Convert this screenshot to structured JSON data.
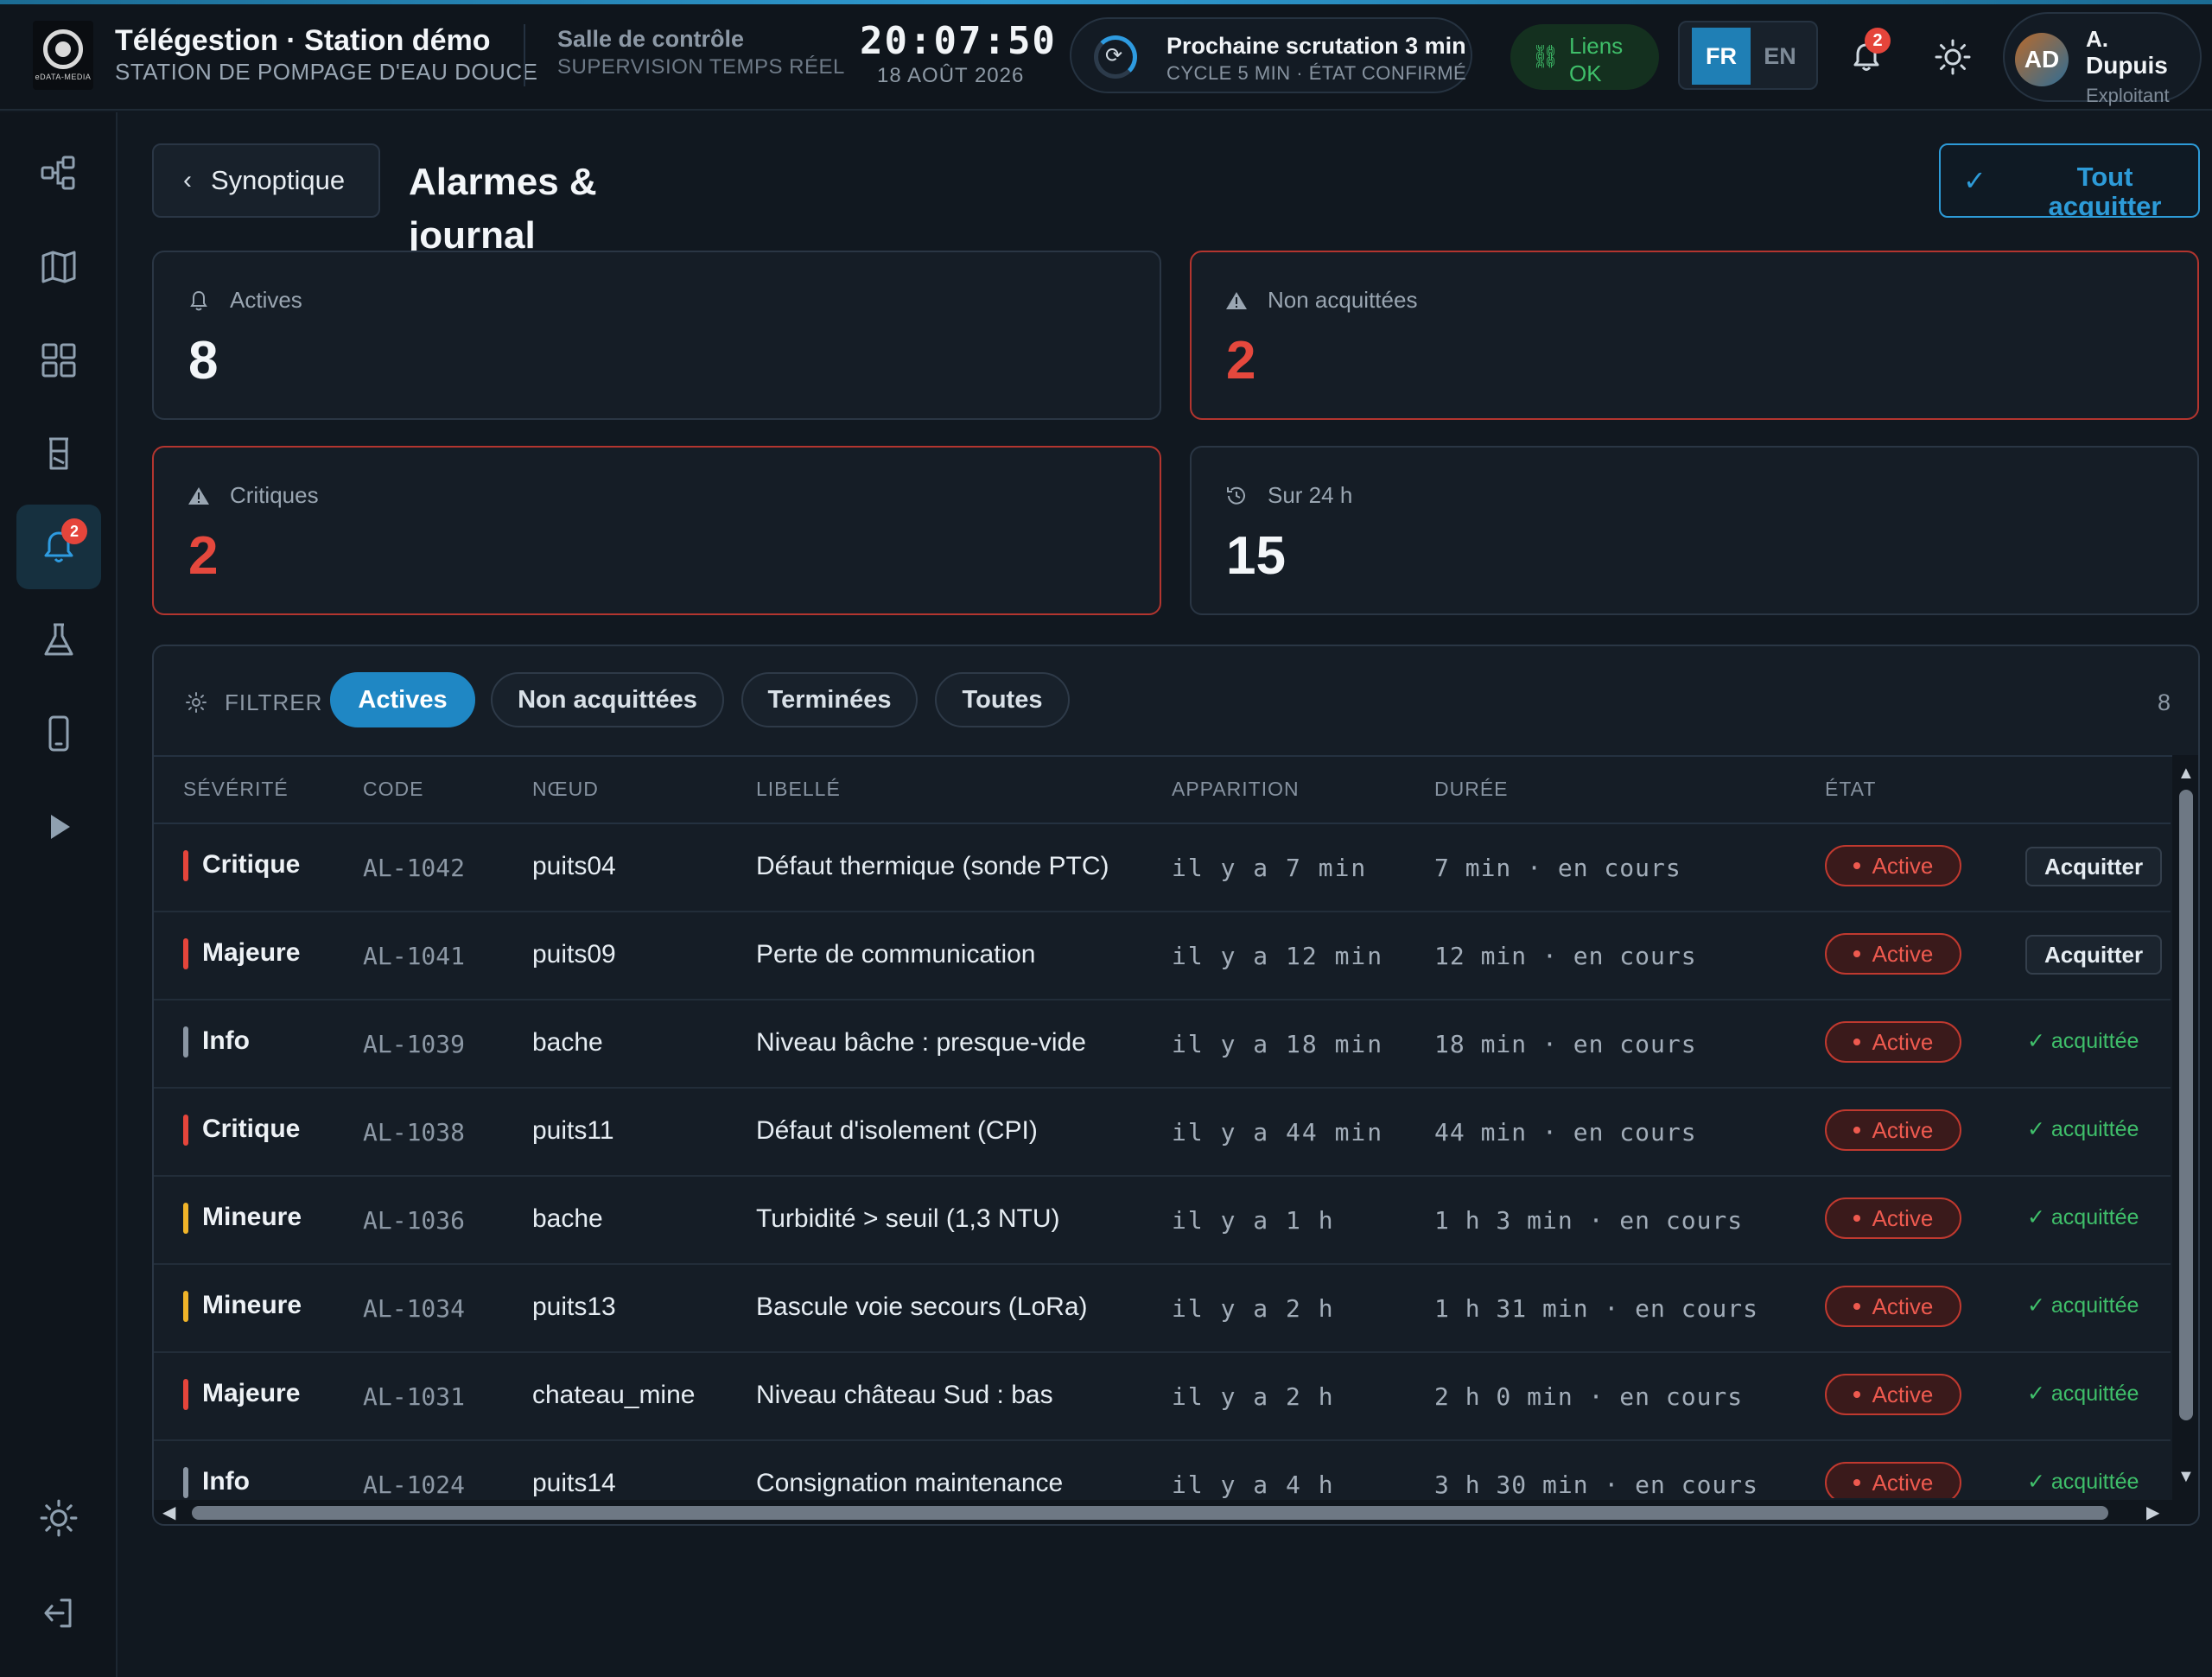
{
  "app": {
    "title": "Télégestion · Station démo",
    "subtitle": "STATION DE POMPAGE D'EAU DOUCE",
    "logo_text": "eDATA-MEDIA"
  },
  "control": {
    "title": "Salle de contrôle",
    "subtitle": "SUPERVISION TEMPS RÉEL"
  },
  "clock": {
    "time": "20:07:50",
    "date": "18 AOÛT 2026"
  },
  "scan": {
    "title": "Prochaine scrutation 3 min",
    "subtitle": "CYCLE 5 MIN · ÉTAT CONFIRMÉ"
  },
  "links": {
    "line1": "Liens",
    "line2": "OK"
  },
  "lang": {
    "fr": "FR",
    "en": "EN",
    "active": "FR"
  },
  "notifications": {
    "count": "2"
  },
  "user": {
    "initials": "AD",
    "name_line1": "A.",
    "name_line2": "Dupuis",
    "role": "Exploitant"
  },
  "sidebar": {
    "items": [
      {
        "icon": "topology-icon"
      },
      {
        "icon": "map-icon"
      },
      {
        "icon": "dashboard-grid-icon"
      },
      {
        "icon": "tank-icon"
      },
      {
        "icon": "alarm-bell-icon",
        "badge": "2",
        "active": true
      },
      {
        "icon": "flask-icon"
      },
      {
        "icon": "mobile-icon"
      },
      {
        "icon": "play-icon"
      }
    ],
    "bottom": [
      {
        "icon": "theme-sun-icon"
      },
      {
        "icon": "logout-icon"
      }
    ]
  },
  "header": {
    "back_label": "Synoptique",
    "page_title": "Alarmes & journal",
    "ack_all_label": "Tout acquitter"
  },
  "stats": [
    {
      "label": "Actives",
      "value": "8",
      "icon": "bell-icon",
      "alert": false
    },
    {
      "label": "Non acquittées",
      "value": "2",
      "icon": "warning-icon",
      "alert": true
    },
    {
      "label": "Critiques",
      "value": "2",
      "icon": "warning-icon",
      "alert": true
    },
    {
      "label": "Sur 24 h",
      "value": "15",
      "icon": "history-icon",
      "alert": false
    }
  ],
  "filter": {
    "label": "FILTRER",
    "chips": [
      {
        "label": "Actives",
        "active": true
      },
      {
        "label": "Non acquittées",
        "active": false
      },
      {
        "label": "Terminées",
        "active": false
      },
      {
        "label": "Toutes",
        "active": false
      }
    ],
    "count": "8"
  },
  "table": {
    "columns": [
      "SÉVÉRITÉ",
      "CODE",
      "NŒUD",
      "LIBELLÉ",
      "APPARITION",
      "DURÉE",
      "ÉTAT"
    ],
    "ack_button_label": "Acquitter",
    "acked_label": "acquittée",
    "rows": [
      {
        "severity": "Critique",
        "sev_color": "#e5453b",
        "code": "AL-1042",
        "node": "puits04",
        "label": "Défaut thermique (sonde PTC)",
        "seen": "il y a 7 min",
        "duration": "7 min · en cours",
        "state": "Active",
        "acked": false
      },
      {
        "severity": "Majeure",
        "sev_color": "#e5453b",
        "code": "AL-1041",
        "node": "puits09",
        "label": "Perte de communication",
        "seen": "il y a 12 min",
        "duration": "12 min · en cours",
        "state": "Active",
        "acked": false
      },
      {
        "severity": "Info",
        "sev_color": "#8a96a3",
        "code": "AL-1039",
        "node": "bache",
        "label": "Niveau bâche : presque-vide",
        "seen": "il y a 18 min",
        "duration": "18 min · en cours",
        "state": "Active",
        "acked": true
      },
      {
        "severity": "Critique",
        "sev_color": "#e5453b",
        "code": "AL-1038",
        "node": "puits11",
        "label": "Défaut d'isolement (CPI)",
        "seen": "il y a 44 min",
        "duration": "44 min · en cours",
        "state": "Active",
        "acked": true
      },
      {
        "severity": "Mineure",
        "sev_color": "#f0b429",
        "code": "AL-1036",
        "node": "bache",
        "label": "Turbidité > seuil (1,3 NTU)",
        "seen": "il y a 1 h",
        "duration": "1 h 3 min · en cours",
        "state": "Active",
        "acked": true
      },
      {
        "severity": "Mineure",
        "sev_color": "#f0b429",
        "code": "AL-1034",
        "node": "puits13",
        "label": "Bascule voie secours (LoRa)",
        "seen": "il y a 2 h",
        "duration": "1 h 31 min · en cours",
        "state": "Active",
        "acked": true
      },
      {
        "severity": "Majeure",
        "sev_color": "#e5453b",
        "code": "AL-1031",
        "node": "chateau_mine",
        "label": "Niveau château Sud : bas",
        "seen": "il y a 2 h",
        "duration": "2 h 0 min · en cours",
        "state": "Active",
        "acked": true
      },
      {
        "severity": "Info",
        "sev_color": "#8a96a3",
        "code": "AL-1024",
        "node": "puits14",
        "label": "Consignation maintenance",
        "seen": "il y a 4 h",
        "duration": "3 h 30 min · en cours",
        "state": "Active",
        "acked": true
      }
    ]
  },
  "colors": {
    "accent": "#1f87c4",
    "danger": "#e5453b",
    "success": "#3fbf6a",
    "warning": "#f0b429"
  }
}
